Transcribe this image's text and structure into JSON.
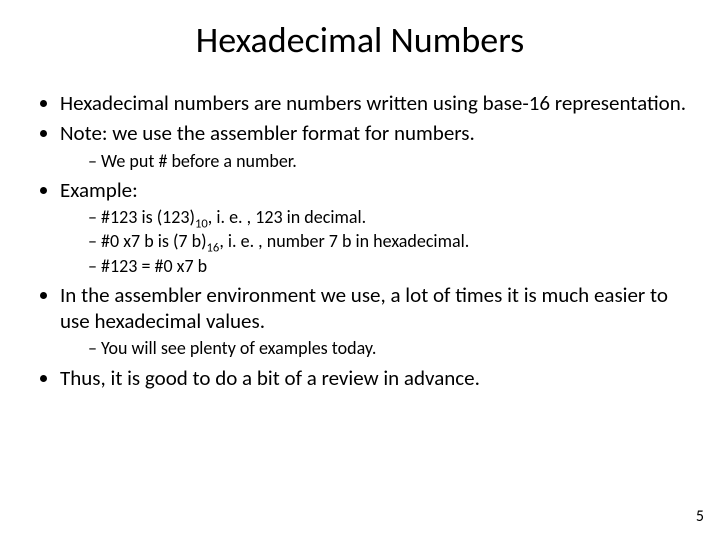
{
  "title": "Hexadecimal Numbers",
  "b1": "Hexadecimal numbers are numbers written using base-16 representation.",
  "b2": "Note: we use the assembler format for numbers.",
  "b2a": "We put # before a number.",
  "b3": "Example:",
  "b3a_pre": "#123 is (123)",
  "b3a_sub": "10",
  "b3a_post": ", i. e. , 123 in decimal.",
  "b3b_pre": "#0 x7 b is (7 b)",
  "b3b_sub": "16",
  "b3b_post": ", i. e. , number 7 b in hexadecimal.",
  "b3c": "#123 = #0 x7 b",
  "b4": "In the assembler environment we use, a lot of times it is much easier to use hexadecimal values.",
  "b4a": "You will see plenty of examples today.",
  "b5": "Thus, it is good to do a bit of a review in advance.",
  "pagenum": "5"
}
